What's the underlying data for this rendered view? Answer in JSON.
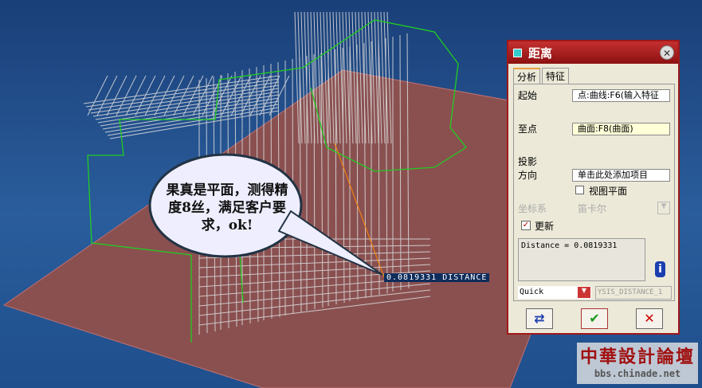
{
  "viewport": {
    "callout": "果真是平面，测得精度8丝，满足客户要求，ok!",
    "dimension_label": "0.0819331  DISTANCE"
  },
  "dialog": {
    "title": "距离",
    "tabs": [
      "分析",
      "特征"
    ],
    "from_label": "起始",
    "from_value": "点:曲线:F6(输入特征",
    "to_label": "至点",
    "to_value": "曲面:F8(曲面)",
    "projection_label": "投影",
    "direction_label": "方向",
    "direction_value": "单击此处添加项目",
    "view_plane_label": "视图平面",
    "csys_label": "坐标系",
    "csys_value": "笛卡尔",
    "update_label": "更新",
    "result": "Distance = 0.0819331",
    "mode": "Quick",
    "feature_name": "YSIS_DISTANCE_1"
  },
  "watermark": {
    "line1": "中華設計論壇",
    "line2": "bbs.chinade.net"
  }
}
